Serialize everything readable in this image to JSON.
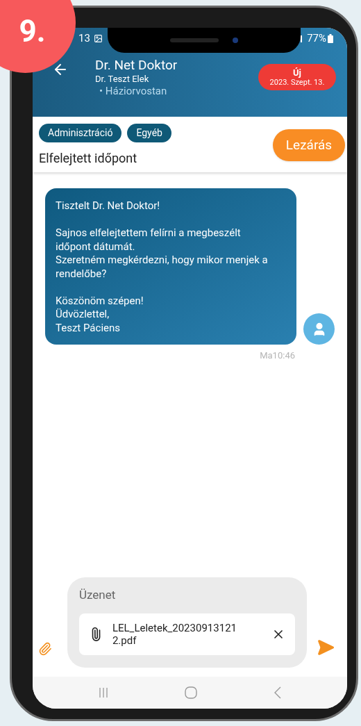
{
  "badge": "9.",
  "status_bar": {
    "time": "13",
    "battery": "77%"
  },
  "header": {
    "title": "Dr. Net Doktor",
    "doctor": "Dr. Teszt Elek",
    "specialty": "• Háziorvostan",
    "status": {
      "label": "Új",
      "date": "2023. Szept. 13."
    }
  },
  "tags": [
    "Adminisztráció",
    "Egyéb"
  ],
  "subject": "Elfelejtett időpont",
  "close_button": "Lezárás",
  "messages": [
    {
      "text": "Tisztelt Dr. Net Doktor!\n\nSajnos elfelejtettem felírni a megbeszélt időpont dátumát.\nSzeretném megkérdezni, hogy mikor menjek a rendelőbe?\n\nKöszönöm szépen!\nÜdvözlettel,\nTeszt Páciens",
      "time": "Ma10:46"
    }
  ],
  "composer": {
    "placeholder": "Üzenet",
    "attachment": "LEL_Leletek_202309131212.pdf"
  }
}
